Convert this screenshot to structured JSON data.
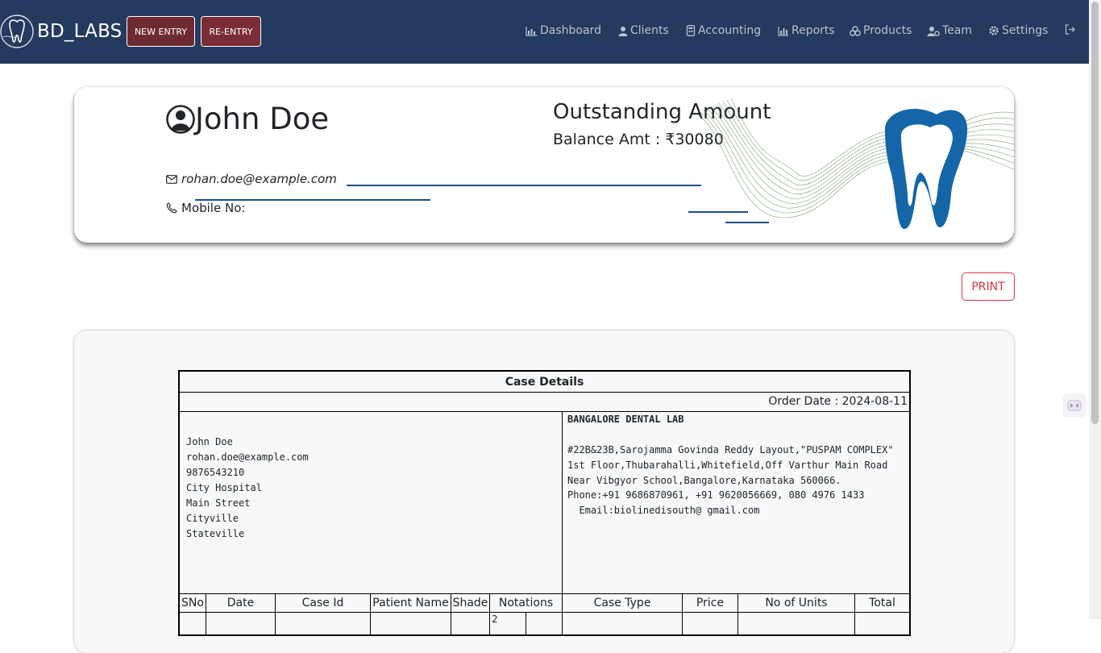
{
  "navbar": {
    "brand": "BD_LABS",
    "new_entry": "NEW ENTRY",
    "re_entry": "RE-ENTRY",
    "links": {
      "dashboard": "Dashboard",
      "clients": "Clients",
      "accounting": "Accounting",
      "reports": "Reports",
      "products": "Products",
      "team": "Team",
      "settings": "Settings"
    },
    "colors": {
      "background": "#243a5e",
      "new_entry_bg": "#6e2a33",
      "link": "#b9c2d0"
    }
  },
  "profile": {
    "name": "John Doe",
    "email": "rohan.doe@example.com",
    "mobile_label": "Mobile No:",
    "outstanding_title": "Outstanding Amount",
    "balance": "Balance Amt : ₹30080"
  },
  "actions": {
    "print": "PRINT"
  },
  "case_details": {
    "title": "Case Details",
    "order_date": "Order Date : 2024-08-11",
    "client_block": [
      "John Doe",
      "rohan.doe@example.com",
      "9876543210",
      "City Hospital",
      "Main Street",
      "Cityville",
      "Stateville"
    ],
    "lab_name": "BANGALORE DENTAL LAB",
    "lab_address": [
      "#22B&23B,Sarojamma Govinda Reddy Layout,\"PUSPAM COMPLEX\"",
      "1st Floor,Thubarahalli,Whitefield,Off Varthur Main Road",
      "Near Vibgyor School,Bangalore,Karnataka 560066.",
      "Phone:+91 9686870961, +91 9620056669, 080 4976 1433",
      "  Email:biolinedisouth@ gmail.com"
    ],
    "columns": [
      "SNo",
      "Date",
      "Case Id",
      "Patient Name",
      "Shade",
      "Notations",
      "Case Type",
      "Price",
      "No of Units",
      "Total"
    ],
    "first_row_partial": "2"
  }
}
